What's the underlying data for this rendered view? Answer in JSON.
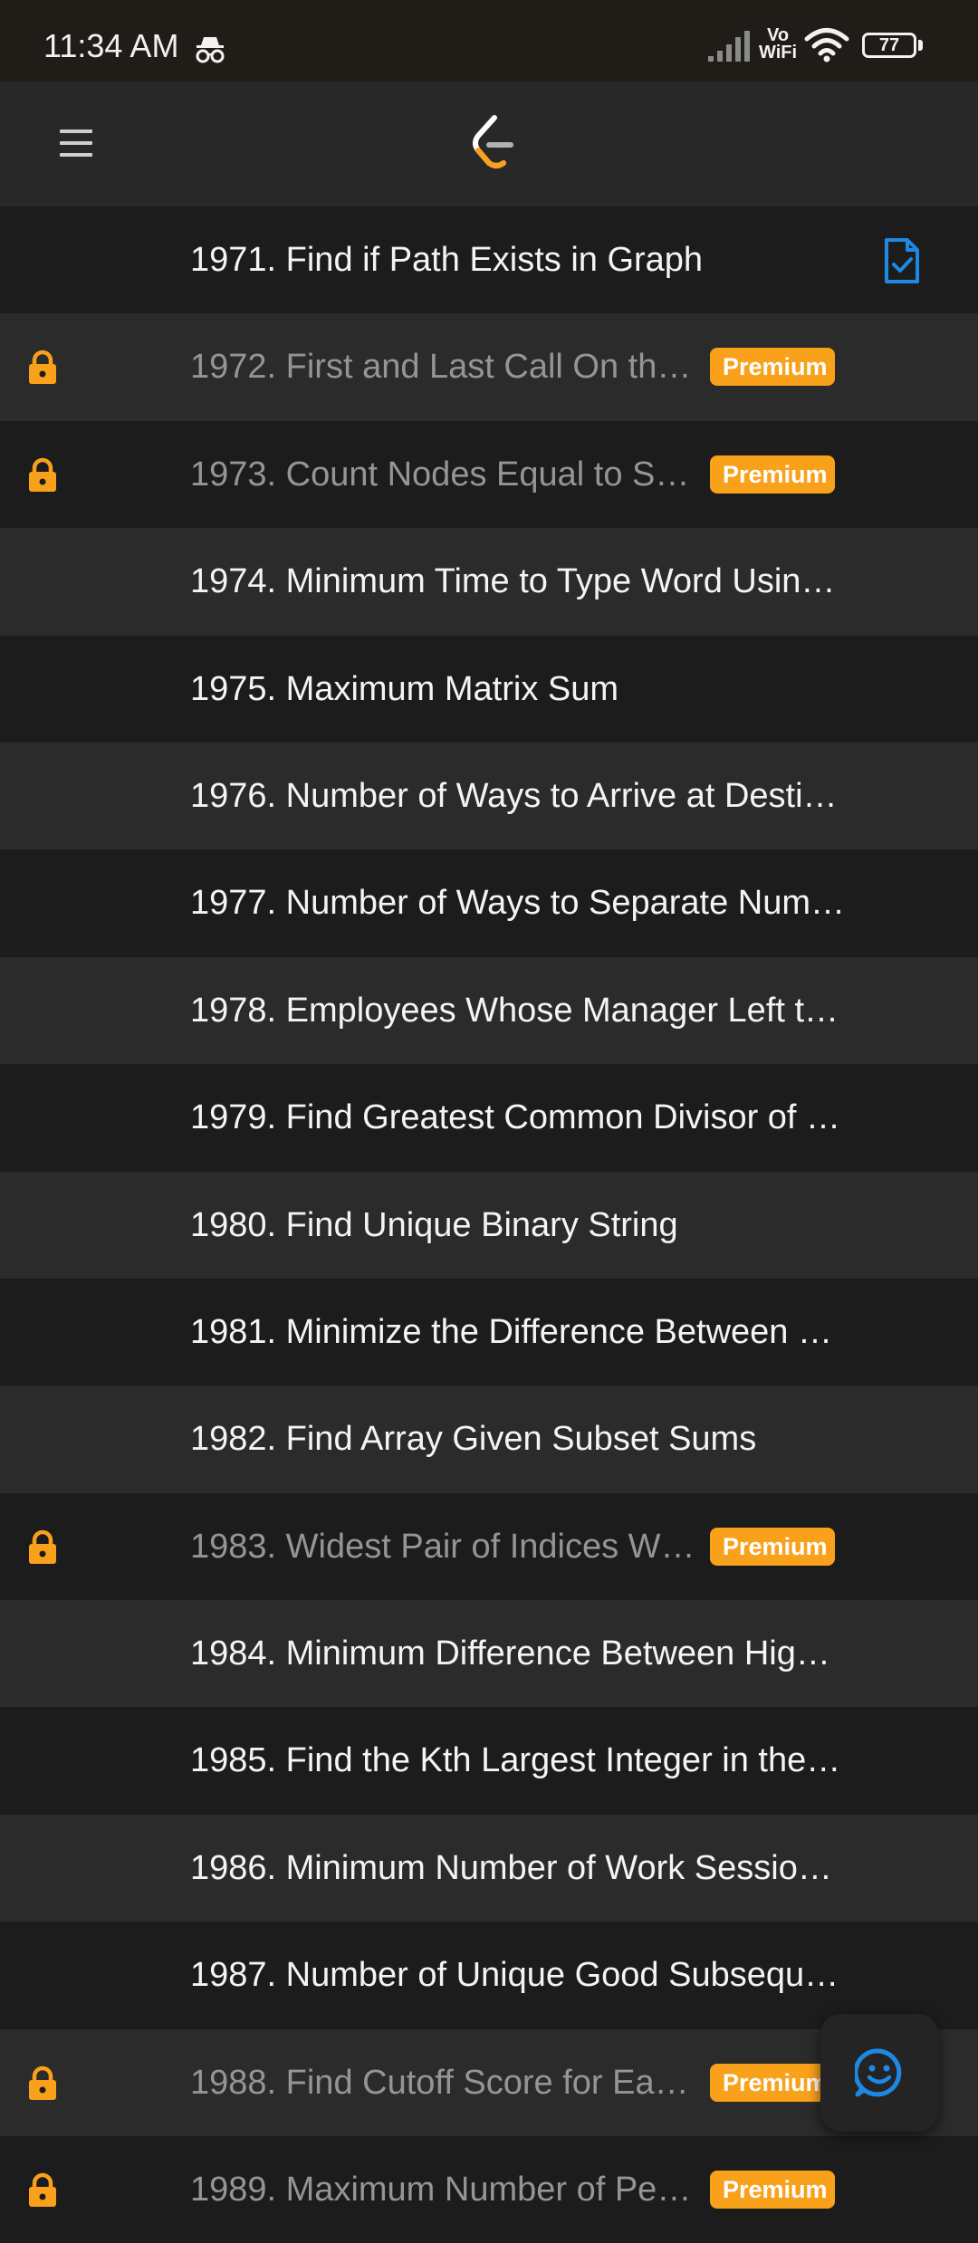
{
  "status_bar": {
    "time": "11:34 AM",
    "vowifi_top": "Vo",
    "vowifi_bottom": "WiFi",
    "battery_level": "77",
    "icons": [
      "incognito-icon",
      "signal-icon",
      "wifi-icon",
      "battery-icon"
    ]
  },
  "header": {
    "menu_icon": "hamburger-menu-icon",
    "logo_icon": "leetcode-logo-icon"
  },
  "colors": {
    "premium_badge": "#f9a11b",
    "lock_icon": "#f9a11b",
    "solved_icon": "#1e88e5",
    "fab_icon": "#1e88e5",
    "row_dark": "#1c1c1c",
    "row_light": "#2b2b2b"
  },
  "problems": [
    {
      "title": "1971. Find if Path Exists in Graph",
      "locked": false,
      "premium_label": "",
      "solved": true
    },
    {
      "title": "1972. First and Last Call On th…",
      "locked": true,
      "premium_label": "Premium",
      "solved": false
    },
    {
      "title": "1973. Count Nodes Equal to S…",
      "locked": true,
      "premium_label": "Premium",
      "solved": false
    },
    {
      "title": "1974. Minimum Time to Type Word Usin…",
      "locked": false,
      "premium_label": "",
      "solved": false
    },
    {
      "title": "1975. Maximum Matrix Sum",
      "locked": false,
      "premium_label": "",
      "solved": false
    },
    {
      "title": "1976. Number of Ways to Arrive at Desti…",
      "locked": false,
      "premium_label": "",
      "solved": false
    },
    {
      "title": "1977. Number of Ways to Separate Num…",
      "locked": false,
      "premium_label": "",
      "solved": false
    },
    {
      "title": "1978. Employees Whose Manager Left t…",
      "locked": false,
      "premium_label": "",
      "solved": false
    },
    {
      "title": "1979. Find Greatest Common Divisor of …",
      "locked": false,
      "premium_label": "",
      "solved": false
    },
    {
      "title": "1980. Find Unique Binary String",
      "locked": false,
      "premium_label": "",
      "solved": false
    },
    {
      "title": "1981. Minimize the Difference Between …",
      "locked": false,
      "premium_label": "",
      "solved": false
    },
    {
      "title": "1982. Find Array Given Subset Sums",
      "locked": false,
      "premium_label": "",
      "solved": false
    },
    {
      "title": "1983. Widest Pair of Indices W…",
      "locked": true,
      "premium_label": "Premium",
      "solved": false
    },
    {
      "title": "1984. Minimum Difference Between Hig…",
      "locked": false,
      "premium_label": "",
      "solved": false
    },
    {
      "title": "1985. Find the Kth Largest Integer in the…",
      "locked": false,
      "premium_label": "",
      "solved": false
    },
    {
      "title": "1986. Minimum Number of Work Sessio…",
      "locked": false,
      "premium_label": "",
      "solved": false
    },
    {
      "title": "1987. Number of Unique Good Subsequ…",
      "locked": false,
      "premium_label": "",
      "solved": false
    },
    {
      "title": "1988. Find Cutoff Score for Ea…",
      "locked": true,
      "premium_label": "Premium",
      "solved": false
    },
    {
      "title": "1989. Maximum Number of Pe…",
      "locked": true,
      "premium_label": "Premium",
      "solved": false
    }
  ],
  "fab": {
    "icon": "smiley-feedback-icon"
  }
}
